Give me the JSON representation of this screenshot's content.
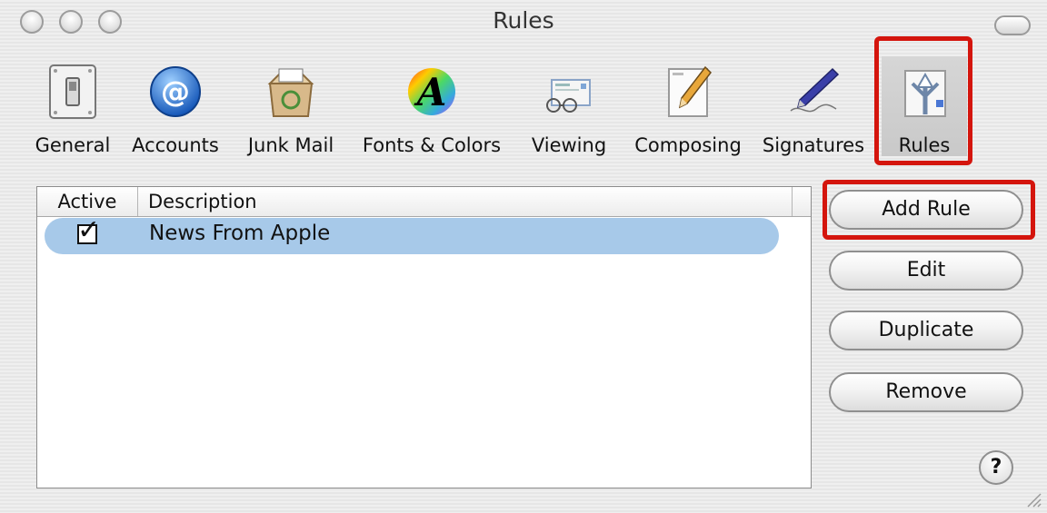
{
  "window": {
    "title": "Rules"
  },
  "toolbar": {
    "items": [
      {
        "label": "General",
        "icon": "switch-icon"
      },
      {
        "label": "Accounts",
        "icon": "at-icon"
      },
      {
        "label": "Junk Mail",
        "icon": "junk-box-icon"
      },
      {
        "label": "Fonts & Colors",
        "icon": "font-color-icon"
      },
      {
        "label": "Viewing",
        "icon": "glasses-icon"
      },
      {
        "label": "Composing",
        "icon": "pencil-icon"
      },
      {
        "label": "Signatures",
        "icon": "pen-icon"
      },
      {
        "label": "Rules",
        "icon": "rules-arrows-icon",
        "selected": true
      }
    ]
  },
  "table": {
    "headers": {
      "active": "Active",
      "description": "Description"
    },
    "rows": [
      {
        "active": true,
        "check_glyph": "✓",
        "description": "News From Apple"
      }
    ]
  },
  "buttons": {
    "add": "Add Rule",
    "edit": "Edit",
    "duplicate": "Duplicate",
    "remove": "Remove",
    "help": "?"
  },
  "colors": {
    "highlight": "#d4150d",
    "selection": "#a7c9e9"
  }
}
